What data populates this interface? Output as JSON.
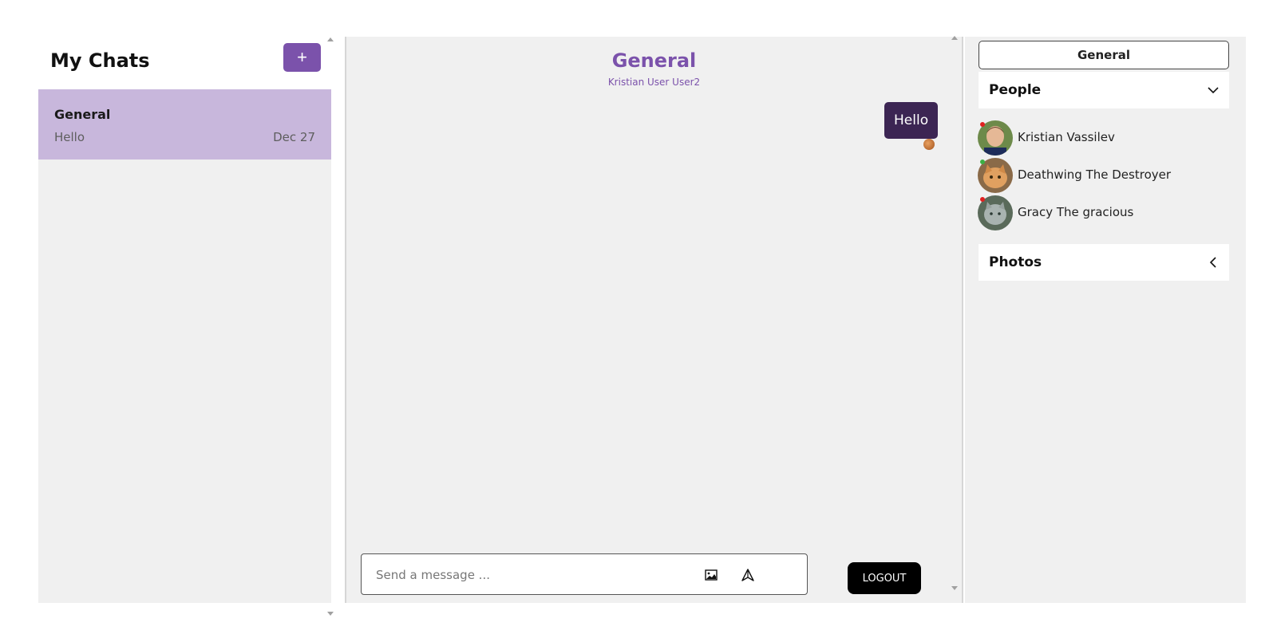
{
  "sidebar": {
    "title": "My Chats",
    "new_chat_label": "+",
    "chats": [
      {
        "name": "General",
        "last_message": "Hello",
        "date": "Dec 27"
      }
    ]
  },
  "chat": {
    "title": "General",
    "members": "Kristian User User2",
    "messages": [
      {
        "text": "Hello",
        "sender_avatar": "avatar-icon"
      }
    ],
    "input_placeholder": "Send a message ...",
    "attach_image_icon": "image-icon",
    "send_icon": "send-icon",
    "logout_label": "LOGOUT"
  },
  "details": {
    "chat_name": "General",
    "people_label": "People",
    "people": [
      {
        "name": "Kristian Vassilev",
        "status": "offline",
        "status_color": "#e02020"
      },
      {
        "name": "Deathwing The Destroyer",
        "status": "online",
        "status_color": "#3cb043"
      },
      {
        "name": "Gracy The gracious",
        "status": "offline",
        "status_color": "#e02020"
      }
    ],
    "photos_label": "Photos"
  },
  "colors": {
    "accent": "#7b52ab",
    "selected_chat": "#c8b7dc",
    "message_bubble": "#3c2553",
    "panel_background": "#f0f0f0"
  }
}
